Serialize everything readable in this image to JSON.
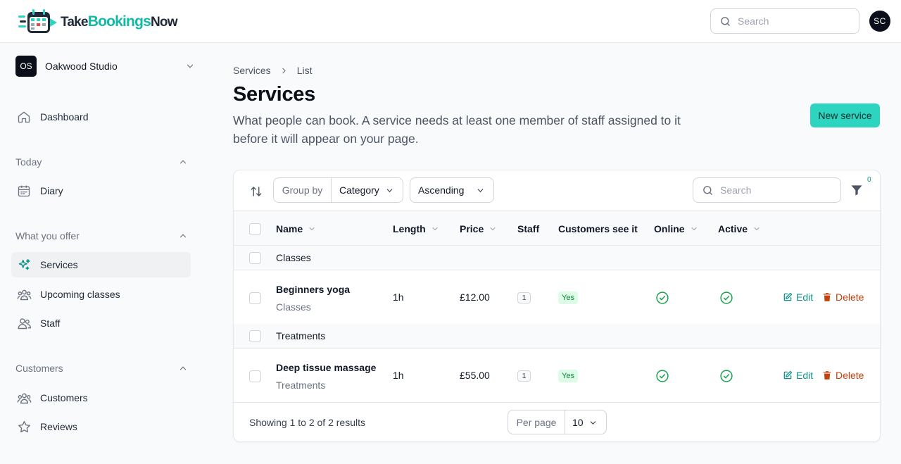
{
  "app": {
    "logo_parts": [
      "Take",
      "Bookings",
      "Now"
    ],
    "search_placeholder": "Search",
    "user_initials": "SC"
  },
  "sidebar": {
    "studio": {
      "initials": "OS",
      "name": "Oakwood Studio"
    },
    "dashboard": "Dashboard",
    "sections": [
      {
        "title": "Today",
        "items": [
          {
            "label": "Diary",
            "icon": "calendar-icon"
          }
        ]
      },
      {
        "title": "What you offer",
        "items": [
          {
            "label": "Services",
            "icon": "sparkles-icon",
            "active": true
          },
          {
            "label": "Upcoming classes",
            "icon": "user-group-icon"
          },
          {
            "label": "Staff",
            "icon": "users-icon"
          }
        ]
      },
      {
        "title": "Customers",
        "items": [
          {
            "label": "Customers",
            "icon": "user-group-icon"
          },
          {
            "label": "Reviews",
            "icon": "star-icon"
          }
        ]
      }
    ]
  },
  "main": {
    "breadcrumb": [
      "Services",
      "List"
    ],
    "title": "Services",
    "description": "What people can book. A service needs at least one member of staff assigned to it before it will appear on your page.",
    "new_button": "New service",
    "accent_color": "#2dd4bf"
  },
  "table": {
    "group_by_label": "Group by",
    "group_by_value": "Category",
    "sort_direction": "Ascending",
    "search_placeholder": "Search",
    "filter_count": "0",
    "columns": [
      "Name",
      "Length",
      "Price",
      "Staff",
      "Customers see it",
      "Online",
      "Active"
    ],
    "groups": [
      {
        "name": "Classes",
        "rows": [
          {
            "name": "Beginners yoga",
            "category": "Classes",
            "length": "1h",
            "price": "£12.00",
            "staff": "1",
            "customers_see_it": "Yes",
            "online": true,
            "active": true
          }
        ]
      },
      {
        "name": "Treatments",
        "rows": [
          {
            "name": "Deep tissue massage",
            "category": "Treatments",
            "length": "1h",
            "price": "£55.00",
            "staff": "1",
            "customers_see_it": "Yes",
            "online": true,
            "active": true
          }
        ]
      }
    ],
    "row_actions": {
      "edit": "Edit",
      "delete": "Delete"
    },
    "footer": {
      "results_text": "Showing 1 to 2 of 2 results",
      "per_page_label": "Per page",
      "per_page_value": "10"
    }
  }
}
